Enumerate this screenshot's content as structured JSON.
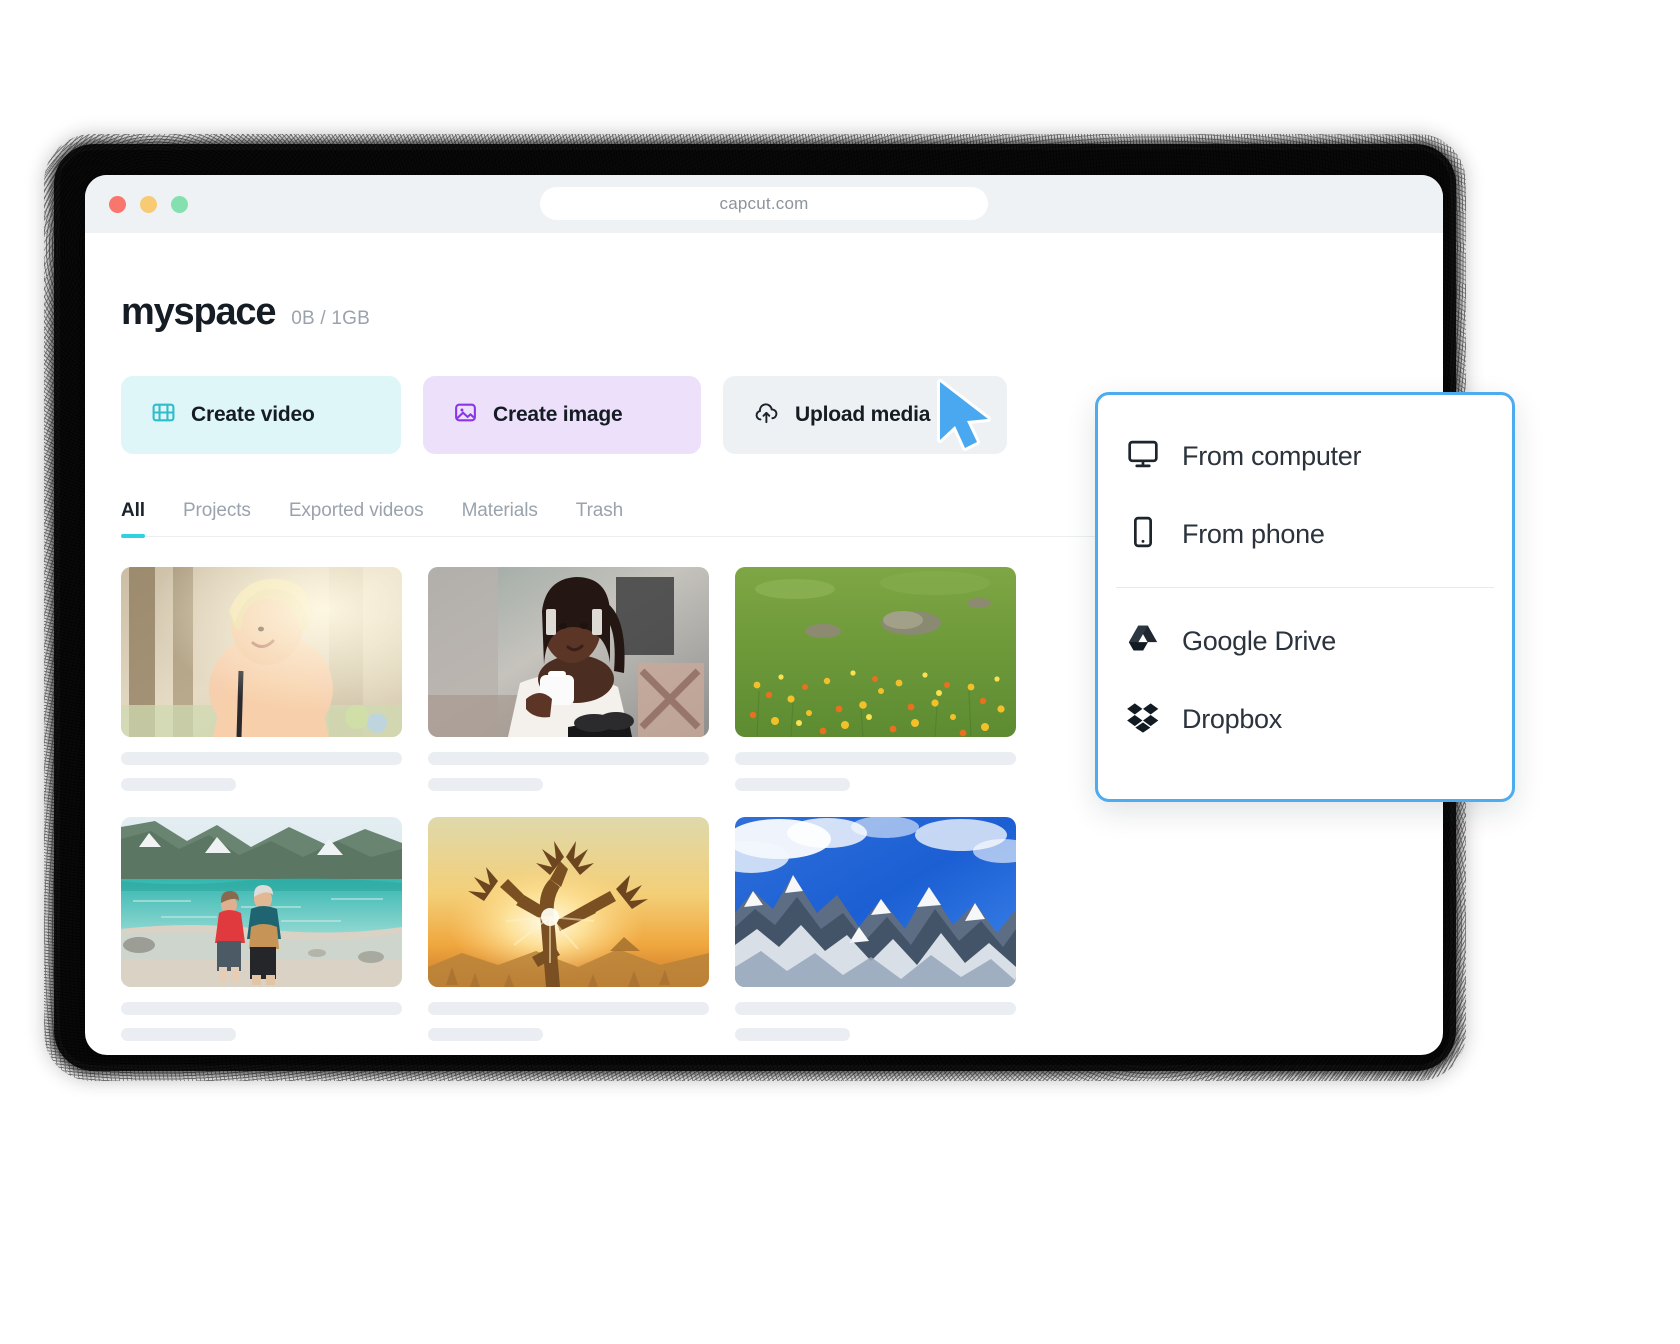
{
  "browser": {
    "url": "capcut.com",
    "traffic_lights": [
      {
        "name": "close",
        "color": "#f8766d"
      },
      {
        "name": "minimize",
        "color": "#f9ca74"
      },
      {
        "name": "maximize",
        "color": "#85e0b0"
      }
    ]
  },
  "header": {
    "brand": "myspace",
    "quota": "0B / 1GB"
  },
  "actions": [
    {
      "label": "Create video",
      "icon": "film-icon",
      "bg": "#dff6f9",
      "accent": "#2fbccc"
    },
    {
      "label": "Create image",
      "icon": "picture-icon",
      "bg": "#ece0fb",
      "accent": "#8b34e8"
    },
    {
      "label": "Upload media",
      "icon": "cloud-upload-icon",
      "bg": "#eef1f3",
      "accent": "#1a222b",
      "chevron": "chevron-down-icon"
    }
  ],
  "tabs": [
    {
      "label": "All",
      "active": true
    },
    {
      "label": "Projects",
      "active": false
    },
    {
      "label": "Exported videos",
      "active": false
    },
    {
      "label": "Materials",
      "active": false
    },
    {
      "label": "Trash",
      "active": false
    }
  ],
  "grid": [
    {
      "name": "thumb-woman-smiling-trees"
    },
    {
      "name": "thumb-woman-coffee-cup"
    },
    {
      "name": "thumb-wildflower-meadow"
    },
    {
      "name": "thumb-couple-lake-beach"
    },
    {
      "name": "thumb-joshua-tree-sunset"
    },
    {
      "name": "thumb-snowy-mountains"
    }
  ],
  "dropdown": {
    "border_color": "#4dabf0",
    "groups": [
      {
        "items": [
          {
            "label": "From computer",
            "icon": "monitor-icon"
          },
          {
            "label": "From phone",
            "icon": "phone-icon"
          }
        ]
      },
      {
        "items": [
          {
            "label": "Google Drive",
            "icon": "google-drive-icon"
          },
          {
            "label": "Dropbox",
            "icon": "dropbox-icon"
          }
        ]
      }
    ]
  },
  "cursor": {
    "name": "pointer-cursor",
    "color": "#4aa8f0"
  }
}
